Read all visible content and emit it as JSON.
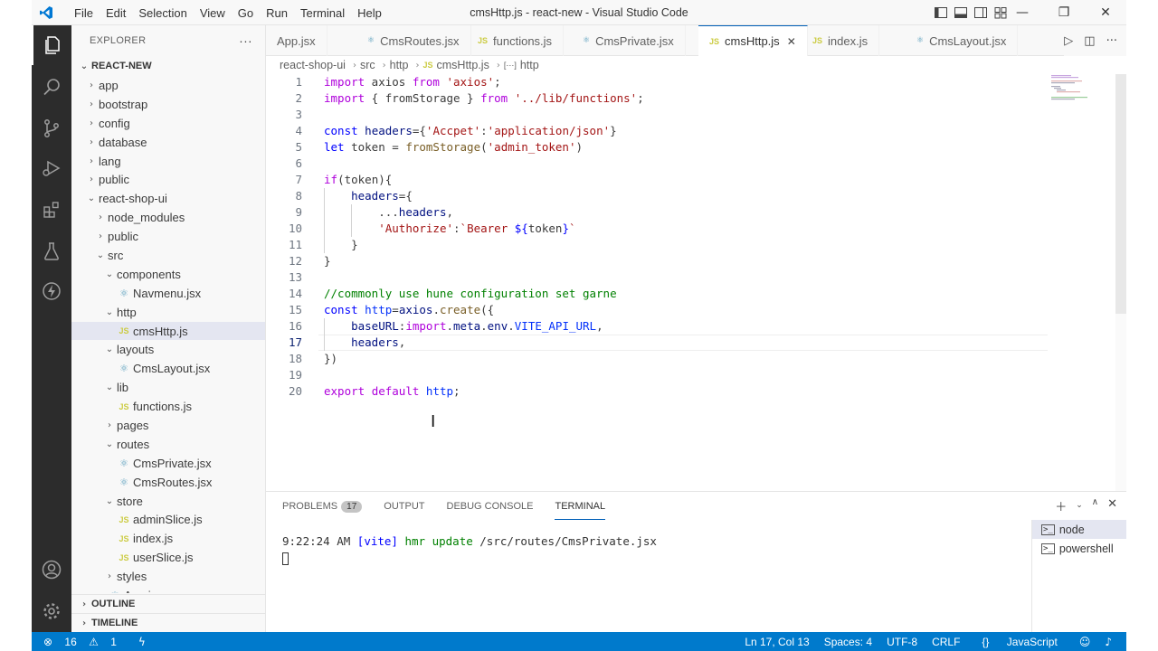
{
  "window": {
    "title": "cmsHttp.js - react-new - Visual Studio Code"
  },
  "menu": [
    "File",
    "Edit",
    "Selection",
    "View",
    "Go",
    "Run",
    "Terminal",
    "Help"
  ],
  "window_controls": {
    "minimize": "—",
    "restore": "❐",
    "close": "✕"
  },
  "sidebar": {
    "header": "EXPLORER",
    "more": "···",
    "root": "REACT-NEW",
    "items": [
      {
        "label": "app",
        "depth": 0,
        "type": "folder",
        "open": false
      },
      {
        "label": "bootstrap",
        "depth": 0,
        "type": "folder",
        "open": false
      },
      {
        "label": "config",
        "depth": 0,
        "type": "folder",
        "open": false
      },
      {
        "label": "database",
        "depth": 0,
        "type": "folder",
        "open": false
      },
      {
        "label": "lang",
        "depth": 0,
        "type": "folder",
        "open": false
      },
      {
        "label": "public",
        "depth": 0,
        "type": "folder",
        "open": false
      },
      {
        "label": "react-shop-ui",
        "depth": 0,
        "type": "folder",
        "open": true
      },
      {
        "label": "node_modules",
        "depth": 1,
        "type": "folder",
        "open": false
      },
      {
        "label": "public",
        "depth": 1,
        "type": "folder",
        "open": false
      },
      {
        "label": "src",
        "depth": 1,
        "type": "folder",
        "open": true
      },
      {
        "label": "components",
        "depth": 2,
        "type": "folder",
        "open": true
      },
      {
        "label": "Navmenu.jsx",
        "depth": 3,
        "type": "jsx"
      },
      {
        "label": "http",
        "depth": 2,
        "type": "folder",
        "open": true
      },
      {
        "label": "cmsHttp.js",
        "depth": 3,
        "type": "js",
        "selected": true
      },
      {
        "label": "layouts",
        "depth": 2,
        "type": "folder",
        "open": true
      },
      {
        "label": "CmsLayout.jsx",
        "depth": 3,
        "type": "jsx"
      },
      {
        "label": "lib",
        "depth": 2,
        "type": "folder",
        "open": true
      },
      {
        "label": "functions.js",
        "depth": 3,
        "type": "js"
      },
      {
        "label": "pages",
        "depth": 2,
        "type": "folder",
        "open": false
      },
      {
        "label": "routes",
        "depth": 2,
        "type": "folder",
        "open": true
      },
      {
        "label": "CmsPrivate.jsx",
        "depth": 3,
        "type": "jsx"
      },
      {
        "label": "CmsRoutes.jsx",
        "depth": 3,
        "type": "jsx"
      },
      {
        "label": "store",
        "depth": 2,
        "type": "folder",
        "open": true
      },
      {
        "label": "adminSlice.js",
        "depth": 3,
        "type": "js"
      },
      {
        "label": "index.js",
        "depth": 3,
        "type": "js"
      },
      {
        "label": "userSlice.js",
        "depth": 3,
        "type": "js"
      },
      {
        "label": "styles",
        "depth": 2,
        "type": "folder",
        "open": false
      },
      {
        "label": "App.jsx",
        "depth": 2,
        "type": "jsx"
      }
    ],
    "outline": "OUTLINE",
    "timeline": "TIMELINE"
  },
  "tabs": [
    {
      "label": "App.jsx",
      "icon": "react"
    },
    {
      "label": "CmsRoutes.jsx",
      "icon": "react"
    },
    {
      "label": "functions.js",
      "icon": "js"
    },
    {
      "label": "CmsPrivate.jsx",
      "icon": "react"
    },
    {
      "label": "cmsHttp.js",
      "icon": "js",
      "active": true
    },
    {
      "label": "index.js",
      "icon": "js"
    },
    {
      "label": "CmsLayout.jsx",
      "icon": "react"
    }
  ],
  "js_badge": "JS",
  "breadcrumb": [
    "react-shop-ui",
    "src",
    "http",
    "cmsHttp.js",
    "http"
  ],
  "editor": {
    "current_line": 17,
    "lines": [
      {
        "n": "1",
        "tokens": [
          [
            "k",
            "import"
          ],
          [
            "p",
            " axios "
          ],
          [
            "k",
            "from"
          ],
          [
            "p",
            " "
          ],
          [
            "s",
            "'axios'"
          ],
          [
            "p",
            ";"
          ]
        ]
      },
      {
        "n": "2",
        "tokens": [
          [
            "k",
            "import"
          ],
          [
            "p",
            " { fromStorage } "
          ],
          [
            "k",
            "from"
          ],
          [
            "p",
            " "
          ],
          [
            "s",
            "'../lib/functions'"
          ],
          [
            "p",
            ";"
          ]
        ]
      },
      {
        "n": "3",
        "tokens": []
      },
      {
        "n": "4",
        "tokens": [
          [
            "b",
            "const"
          ],
          [
            "p",
            " "
          ],
          [
            "v",
            "headers"
          ],
          [
            "p",
            "={"
          ],
          [
            "s",
            "'Accpet'"
          ],
          [
            "p",
            ":"
          ],
          [
            "s",
            "'application/json'"
          ],
          [
            "p",
            "}"
          ]
        ]
      },
      {
        "n": "5",
        "tokens": [
          [
            "b",
            "let"
          ],
          [
            "p",
            " token = "
          ],
          [
            "f",
            "fromStorage"
          ],
          [
            "p",
            "("
          ],
          [
            "s",
            "'admin_token'"
          ],
          [
            "p",
            ")"
          ]
        ]
      },
      {
        "n": "6",
        "tokens": []
      },
      {
        "n": "7",
        "tokens": [
          [
            "k",
            "if"
          ],
          [
            "p",
            "(token){"
          ]
        ]
      },
      {
        "n": "8",
        "tokens": [
          [
            "p",
            "    "
          ],
          [
            "v",
            "headers"
          ],
          [
            "p",
            "={"
          ]
        ]
      },
      {
        "n": "9",
        "tokens": [
          [
            "p",
            "        ..."
          ],
          [
            "v",
            "headers"
          ],
          [
            "p",
            ","
          ]
        ]
      },
      {
        "n": "10",
        "tokens": [
          [
            "p",
            "        "
          ],
          [
            "s",
            "'Authorize'"
          ],
          [
            "p",
            ":"
          ],
          [
            "s",
            "`Bearer "
          ],
          [
            "b",
            "${"
          ],
          [
            "p",
            "token"
          ],
          [
            "b",
            "}"
          ],
          [
            "s",
            "`"
          ]
        ]
      },
      {
        "n": "11",
        "tokens": [
          [
            "p",
            "    }"
          ]
        ]
      },
      {
        "n": "12",
        "tokens": [
          [
            "p",
            "}"
          ]
        ]
      },
      {
        "n": "13",
        "tokens": []
      },
      {
        "n": "14",
        "tokens": [
          [
            "c",
            "//commonly use hune configuration set garne"
          ]
        ]
      },
      {
        "n": "15",
        "tokens": [
          [
            "b",
            "const"
          ],
          [
            "p",
            " "
          ],
          [
            "g",
            "http"
          ],
          [
            "p",
            "="
          ],
          [
            "v",
            "axios"
          ],
          [
            "p",
            "."
          ],
          [
            "f",
            "create"
          ],
          [
            "p",
            "({"
          ]
        ]
      },
      {
        "n": "16",
        "tokens": [
          [
            "p",
            "    "
          ],
          [
            "v",
            "baseURL"
          ],
          [
            "p",
            ":"
          ],
          [
            "k",
            "import"
          ],
          [
            "p",
            "."
          ],
          [
            "v",
            "meta"
          ],
          [
            "p",
            "."
          ],
          [
            "v",
            "env"
          ],
          [
            "p",
            "."
          ],
          [
            "g",
            "VITE_API_URL"
          ],
          [
            "p",
            ","
          ]
        ]
      },
      {
        "n": "17",
        "tokens": [
          [
            "p",
            "    "
          ],
          [
            "v",
            "headers"
          ],
          [
            "p",
            ","
          ]
        ]
      },
      {
        "n": "18",
        "tokens": [
          [
            "p",
            "})"
          ]
        ]
      },
      {
        "n": "19",
        "tokens": []
      },
      {
        "n": "20",
        "tokens": [
          [
            "k",
            "export"
          ],
          [
            "p",
            " "
          ],
          [
            "k",
            "default"
          ],
          [
            "p",
            " "
          ],
          [
            "g",
            "http"
          ],
          [
            "p",
            ";"
          ]
        ]
      }
    ]
  },
  "panel": {
    "tabs": [
      "PROBLEMS",
      "OUTPUT",
      "DEBUG CONSOLE",
      "TERMINAL"
    ],
    "problems_count": "17",
    "active_tab": "TERMINAL",
    "terminal": {
      "time": "9:22:24 AM",
      "tag": "[vite]",
      "msg": "hmr update",
      "path": "/src/routes/CmsPrivate.jsx"
    },
    "terminals": [
      "node",
      "powershell"
    ]
  },
  "status": {
    "errors": "16",
    "warnings": "1",
    "position": "Ln 17, Col 13",
    "spaces": "Spaces: 4",
    "encoding": "UTF-8",
    "eol": "CRLF",
    "language": "JavaScript"
  },
  "colors": {
    "accent": "#007acc",
    "activity_bar": "#2c2c2c",
    "selection": "#e4e6f1"
  }
}
